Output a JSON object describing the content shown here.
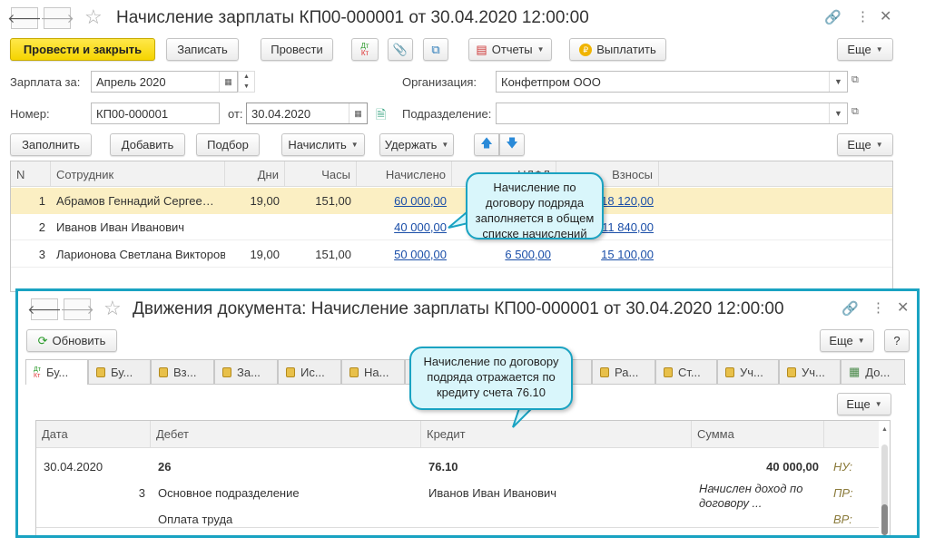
{
  "main_window": {
    "title": "Начисление зарплаты КП00-000001 от 30.04.2020 12:00:00",
    "toolbar": {
      "post_and_close": "Провести и закрыть",
      "save": "Записать",
      "post": "Провести",
      "dt_kt": "Дт Кт",
      "reports": "Отчеты",
      "pay": "Выплатить",
      "more": "Еще"
    },
    "form": {
      "salary_for_label": "Зарплата за:",
      "salary_for_value": "Апрель 2020",
      "organization_label": "Организация:",
      "organization_value": "Конфетпром ООО",
      "number_label": "Номер:",
      "number_value": "КП00-000001",
      "date_label": "от:",
      "date_value": "30.04.2020",
      "department_label": "Подразделение:",
      "department_value": ""
    },
    "table_toolbar": {
      "fill": "Заполнить",
      "add": "Добавить",
      "pick": "Подбор",
      "accrue": "Начислить",
      "withhold": "Удержать",
      "more": "Еще"
    },
    "table": {
      "columns": [
        "N",
        "Сотрудник",
        "Дни",
        "Часы",
        "Начислено",
        "НДФЛ",
        "Взносы"
      ],
      "rows": [
        {
          "n": "1",
          "employee": "Абрамов Геннадий Сергеевич",
          "days": "19,00",
          "hours": "151,00",
          "accrued": "60 000,00",
          "ndfl": "",
          "contrib": "18 120,00"
        },
        {
          "n": "2",
          "employee": "Иванов Иван Иванович",
          "days": "",
          "hours": "",
          "accrued": "40 000,00",
          "ndfl": "",
          "contrib": "11 840,00"
        },
        {
          "n": "3",
          "employee": "Ларионова Светлана Викторовна",
          "days": "19,00",
          "hours": "151,00",
          "accrued": "50 000,00",
          "ndfl": "6 500,00",
          "contrib": "15 100,00"
        }
      ]
    },
    "callout": "Начисление по договору подряда заполняется в общем списке начислений"
  },
  "movements_window": {
    "title": "Движения документа: Начисление зарплаты КП00-000001 от 30.04.2020 12:00:00",
    "refresh": "Обновить",
    "more": "Еще",
    "help": "?",
    "tabs": [
      "Бу...",
      "Бу...",
      "Вз...",
      "За...",
      "Ис...",
      "На...",
      "",
      "",
      "",
      "Ра...",
      "Ст...",
      "Уч...",
      "Уч...",
      "До..."
    ],
    "table_more": "Еще",
    "columns": [
      "Дата",
      "Дебет",
      "Кредит",
      "Сумма"
    ],
    "entry": {
      "date": "30.04.2020",
      "debit": "26",
      "credit": "76.10",
      "amount": "40 000,00",
      "qty": "3",
      "debit_sub1": "Основное подразделение",
      "debit_sub2": "Оплата труда",
      "credit_sub1": "Иванов Иван Иванович",
      "content": "Начислен доход по договору ...",
      "nu": "НУ:",
      "pr": "ПР:",
      "vr": "ВР:"
    },
    "callout": "Начисление по договору подряда отражается по кредиту счета 76.10"
  },
  "colors": {
    "accent_border": "#1aa3c2",
    "primary_button": "#f5d400",
    "selected_row": "#fbefc3",
    "link": "#1a4ea8"
  }
}
